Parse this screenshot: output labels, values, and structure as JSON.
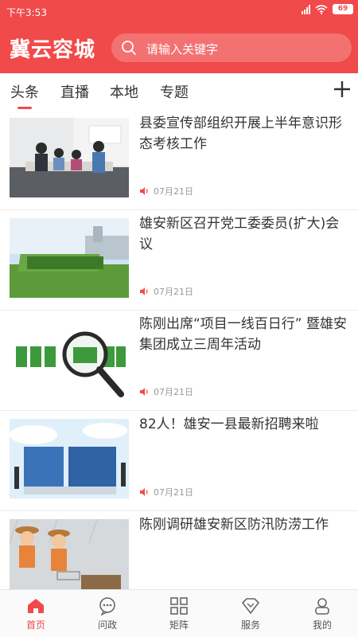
{
  "status": {
    "time": "下午3:53",
    "battery": "69"
  },
  "header": {
    "logo": "冀云容城",
    "search_placeholder": "请输入关键字"
  },
  "tabs": [
    {
      "label": "头条",
      "active": true
    },
    {
      "label": "直播"
    },
    {
      "label": "本地"
    },
    {
      "label": "专题"
    }
  ],
  "news": [
    {
      "title": "县委宣传部组织开展上半年意识形态考核工作",
      "date": "07月21日",
      "image": "office-meeting-photo"
    },
    {
      "title": "雄安新区召开党工委委员(扩大)会议",
      "date": "07月21日",
      "image": "future-city-sign-photo"
    },
    {
      "title": "陈刚出席“项目一线百日行” 暨雄安集团成立三周年活动",
      "date": "07月21日",
      "image": "news-magnifier-graphic"
    },
    {
      "title": "82人！雄安一县最新招聘来啦",
      "date": "07月21日",
      "image": "recruitment-graphic"
    },
    {
      "title": "陈刚调研雄安新区防汛防涝工作",
      "date": "",
      "image": "flood-control-cartoon"
    }
  ],
  "tabbar": [
    {
      "label": "首页",
      "icon": "home-icon",
      "active": true
    },
    {
      "label": "问政",
      "icon": "chat-bubble-icon"
    },
    {
      "label": "矩阵",
      "icon": "grid-icon"
    },
    {
      "label": "服务",
      "icon": "diamond-icon"
    },
    {
      "label": "我的",
      "icon": "user-icon"
    }
  ],
  "colors": {
    "brand": "#f04a4a"
  }
}
